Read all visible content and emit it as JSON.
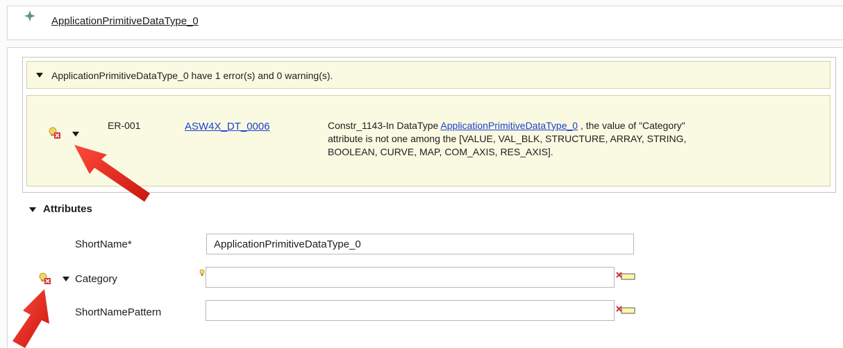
{
  "header": {
    "title_link": "ApplicationPrimitiveDataType_0"
  },
  "validation": {
    "summary": "ApplicationPrimitiveDataType_0 have 1 error(s) and 0 warning(s).",
    "error": {
      "code": "ER-001",
      "rule_link": "ASW4X_DT_0006",
      "message_prefix": "Constr_1143-In DataType ",
      "message_link": "ApplicationPrimitiveDataType_0",
      "message_suffix_1": " , the value of \"Category\"",
      "message_line2": "attribute is not one among the [VALUE, VAL_BLK, STRUCTURE, ARRAY, STRING,",
      "message_line3": "BOOLEAN, CURVE, MAP, COM_AXIS, RES_AXIS]."
    }
  },
  "attributes": {
    "section_title": "Attributes",
    "fields": [
      {
        "label": "ShortName*",
        "value": "ApplicationPrimitiveDataType_0"
      },
      {
        "label": "Category",
        "value": ""
      },
      {
        "label": "ShortNamePattern",
        "value": ""
      }
    ]
  },
  "icons": {
    "header": "diamond-star-icon",
    "error_marker": "bulb-error-icon",
    "clear_field": "clear-field-icon",
    "annotation": "arrow-annotation"
  },
  "colors": {
    "error_panel": "#fafae2",
    "link": "#1a3fd1",
    "arrow": "#e3271b"
  }
}
